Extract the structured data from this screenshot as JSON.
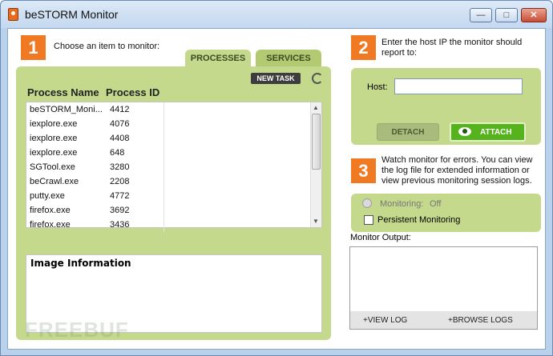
{
  "window": {
    "title": "beSTORM Monitor",
    "controls": [
      "minimize",
      "maximize",
      "close"
    ]
  },
  "step1": {
    "number": "1",
    "text": "Choose an item to monitor:",
    "tabs": [
      {
        "label": "PROCESSES",
        "active": true
      },
      {
        "label": "SERVICES",
        "active": false
      }
    ],
    "new_task_label": "NEW TASK",
    "columns": [
      "Process Name",
      "Process ID"
    ],
    "rows": [
      {
        "name": "beSTORM_Moni...",
        "pid": "4412"
      },
      {
        "name": "iexplore.exe",
        "pid": "4076"
      },
      {
        "name": "iexplore.exe",
        "pid": "4408"
      },
      {
        "name": "iexplore.exe",
        "pid": "648"
      },
      {
        "name": "SGTool.exe",
        "pid": "3280"
      },
      {
        "name": "beCrawl.exe",
        "pid": "2208"
      },
      {
        "name": "putty.exe",
        "pid": "4772"
      },
      {
        "name": "firefox.exe",
        "pid": "3692"
      },
      {
        "name": "firefox.exe",
        "pid": "3436"
      }
    ],
    "image_info_title": "Image Information"
  },
  "step2": {
    "number": "2",
    "text_line1": "Enter the host IP the monitor should",
    "text_line2": "report to:",
    "host_label": "Host:",
    "host_value": "",
    "detach_label": "DETACH",
    "attach_label": "ATTACH"
  },
  "step3": {
    "number": "3",
    "text_line1": "Watch monitor for errors. You can view",
    "text_line2": "the log file for extended information or",
    "text_line3": "view previous monitoring session logs.",
    "monitoring_label": "Monitoring:",
    "monitoring_value": "Off",
    "persistent_label": "Persistent Monitoring",
    "persistent_checked": false
  },
  "output": {
    "label": "Monitor Output:",
    "view_log": "+VIEW LOG",
    "browse_logs": "+BROWSE LOGS"
  },
  "watermark": "FREEBUF",
  "colors": {
    "accent_orange": "#f07a23",
    "panel_green": "#c5d98d",
    "attach_green": "#55b41e"
  }
}
